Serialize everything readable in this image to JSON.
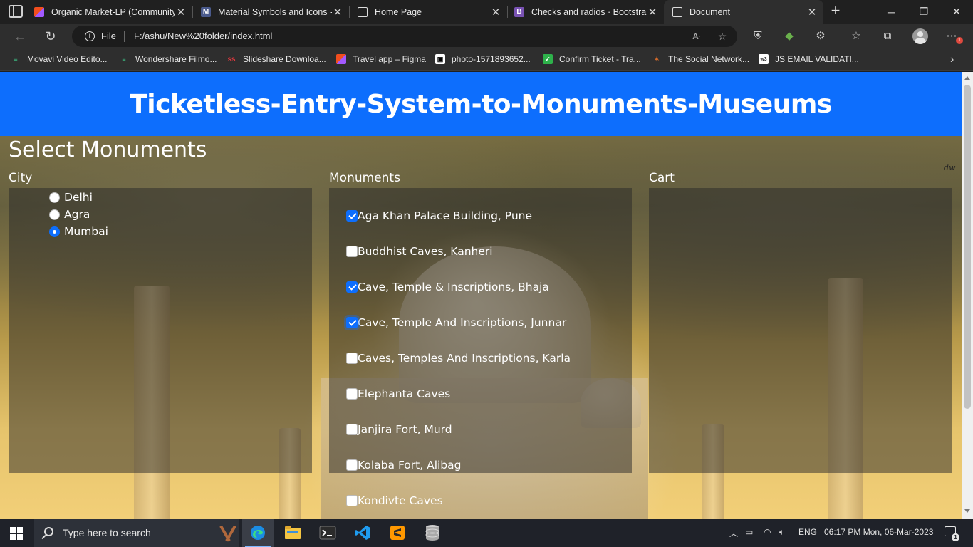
{
  "browser": {
    "tabs": [
      {
        "title": "Organic Market-LP (Community",
        "icon": "figma-icon",
        "color": "#f24e1e"
      },
      {
        "title": "Material Symbols and Icons -",
        "icon": "google-fonts-icon",
        "color": "#4a5a8c"
      },
      {
        "title": "Home Page",
        "icon": "page-icon",
        "color": "#ffffff"
      },
      {
        "title": "Checks and radios · Bootstrap",
        "icon": "bootstrap-icon",
        "color": "#7952b3"
      },
      {
        "title": "Document",
        "icon": "page-icon",
        "color": "#ffffff"
      }
    ],
    "address": {
      "scheme": "File",
      "url": "F:/ashu/New%20folder/index.html"
    },
    "bookmarks": [
      {
        "label": "Movavi Video Edito...",
        "icon": "movavi-icon",
        "color": "#3ecf8e"
      },
      {
        "label": "Wondershare Filmo...",
        "icon": "filmora-icon",
        "color": "#3ecf8e"
      },
      {
        "label": "Slideshare Downloa...",
        "icon": "slideshare-icon",
        "color": "#e0383e"
      },
      {
        "label": "Travel app – Figma",
        "icon": "figma-icon",
        "color": "#f24e1e"
      },
      {
        "label": "photo-1571893652...",
        "icon": "image-icon",
        "color": "#ffffff"
      },
      {
        "label": "Confirm Ticket - Tra...",
        "icon": "confirmticket-icon",
        "color": "#2eb24b"
      },
      {
        "label": "The Social Network...",
        "icon": "social-icon",
        "color": "#d46a2a"
      },
      {
        "label": "JS EMAIL VALIDATI...",
        "icon": "w3schools-icon",
        "color": "#ffffff"
      }
    ],
    "notification_count": "1"
  },
  "page": {
    "header_title": "Ticketless-Entry-System-to-Monuments-Museums",
    "section_title": "Select Monuments",
    "columns": {
      "city": "City",
      "monuments": "Monuments",
      "cart": "Cart"
    },
    "cities": [
      {
        "label": "Delhi",
        "checked": false
      },
      {
        "label": "Agra",
        "checked": false
      },
      {
        "label": "Mumbai",
        "checked": true
      }
    ],
    "monuments": [
      {
        "label": "Aga Khan Palace Building, Pune",
        "checked": true
      },
      {
        "label": "Buddhist Caves, Kanheri",
        "checked": false
      },
      {
        "label": "Cave, Temple & Inscriptions, Bhaja",
        "checked": true
      },
      {
        "label": "Cave, Temple And Inscriptions, Junnar",
        "checked": true
      },
      {
        "label": "Caves, Temples And Inscriptions, Karla",
        "checked": false
      },
      {
        "label": "Elephanta Caves",
        "checked": false
      },
      {
        "label": "Janjira Fort, Murd",
        "checked": false
      },
      {
        "label": "Kolaba Fort, Alibag",
        "checked": false
      },
      {
        "label": "Kondivte Caves",
        "checked": false
      }
    ],
    "corner_text": "dw"
  },
  "taskbar": {
    "search_placeholder": "Type here to search",
    "language": "ENG",
    "clock": "06:17 PM Mon, 06-Mar-2023",
    "notification_badge": "1",
    "apps": [
      "edge-icon",
      "file-explorer-icon",
      "terminal-icon",
      "vscode-icon",
      "sublime-icon",
      "database-icon"
    ]
  }
}
